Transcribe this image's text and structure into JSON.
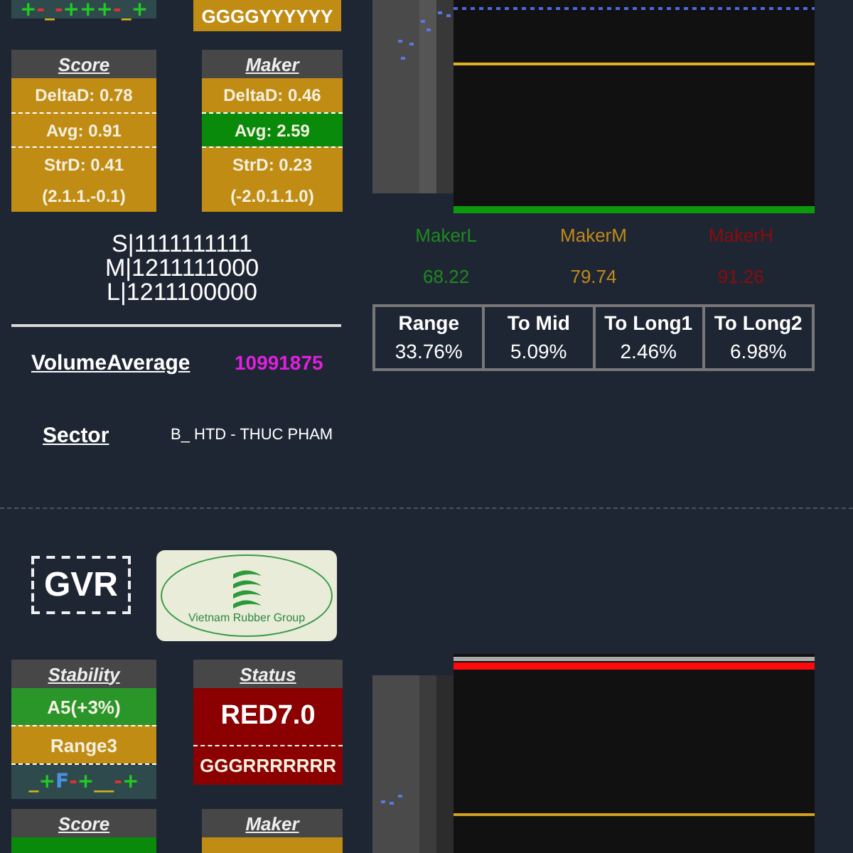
{
  "top": {
    "stability_marks": [
      {
        "text": "+",
        "color": "#22cc22"
      },
      {
        "text": "-",
        "color": "#dd3333"
      },
      {
        "text": "_",
        "color": "#d4b020"
      },
      {
        "text": "-",
        "color": "#dd3333"
      },
      {
        "text": "+++",
        "color": "#22cc22"
      },
      {
        "text": "-",
        "color": "#dd3333"
      },
      {
        "text": "_",
        "color": "#d4b020"
      },
      {
        "text": "+",
        "color": "#22cc22"
      }
    ],
    "status": {
      "pattern": "GGGGYYYYYY",
      "color": "#c08c14"
    },
    "cards": [
      {
        "title": "Score",
        "rows": [
          {
            "kind": "metric",
            "text": "DeltaD: 0.78",
            "color": "#c08c14"
          },
          {
            "kind": "metric",
            "text": "Avg: 0.91",
            "color": "#c08c14"
          },
          {
            "kind": "metric",
            "text": "StrD: 0.41",
            "color": "#c08c14"
          },
          {
            "kind": "note",
            "text": "(2.1.1.-0.1)",
            "color": "#c08c14"
          }
        ]
      },
      {
        "title": "Maker",
        "rows": [
          {
            "kind": "metric",
            "text": "DeltaD: 0.46",
            "color": "#c08c14"
          },
          {
            "kind": "metric",
            "text": "Avg: 2.59",
            "color": "#0a8a0a"
          },
          {
            "kind": "metric",
            "text": "StrD: 0.23",
            "color": "#c08c14"
          },
          {
            "kind": "note",
            "text": "(-2.0.1.1.0)",
            "color": "#c08c14"
          }
        ]
      }
    ],
    "signal_lines": [
      "S|1111111111",
      "M|1211111000",
      "L|1211100000"
    ],
    "volume": {
      "label": "VolumeAverage",
      "value": "10991875"
    },
    "sector": {
      "label": "Sector",
      "value": "B_ HTD - THUC PHAM"
    },
    "makers": [
      {
        "label": "MakerL",
        "value": "68.22",
        "color": "#1e8a1e"
      },
      {
        "label": "MakerM",
        "value": "79.74",
        "color": "#c08a1a"
      },
      {
        "label": "MakerH",
        "value": "91.26",
        "color": "#8b0c0c"
      }
    ],
    "table": [
      {
        "header": "Range",
        "value": "33.76%"
      },
      {
        "header": "To Mid",
        "value": "5.09%"
      },
      {
        "header": "To Long1",
        "value": "2.46%"
      },
      {
        "header": "To Long2",
        "value": "6.98%"
      }
    ]
  },
  "bottom": {
    "ticker": "GVR",
    "logo_text": "Vietnam Rubber Group",
    "stability": {
      "title": "Stability",
      "rows": [
        {
          "text": "A5(+3%)",
          "color": "#2a962a"
        },
        {
          "text": "Range3",
          "color": "#c08c14"
        }
      ],
      "marks": [
        {
          "text": "_",
          "color": "#d4b020"
        },
        {
          "text": "+",
          "color": "#22cc22"
        },
        {
          "text": "F",
          "color": "#4a90e0"
        },
        {
          "text": "-",
          "color": "#dd3333"
        },
        {
          "text": "+",
          "color": "#22cc22"
        },
        {
          "text": "__",
          "color": "#d4b020"
        },
        {
          "text": "-",
          "color": "#dd3333"
        },
        {
          "text": "+",
          "color": "#22cc22"
        }
      ]
    },
    "status": {
      "title": "Status",
      "value": "RED7.0",
      "pattern": "GGGRRRRRRR",
      "color": "#8b0000"
    },
    "cards": [
      {
        "title": "Score",
        "color": "#0a8a0a"
      },
      {
        "title": "Maker",
        "color": "#c08c14"
      }
    ]
  }
}
